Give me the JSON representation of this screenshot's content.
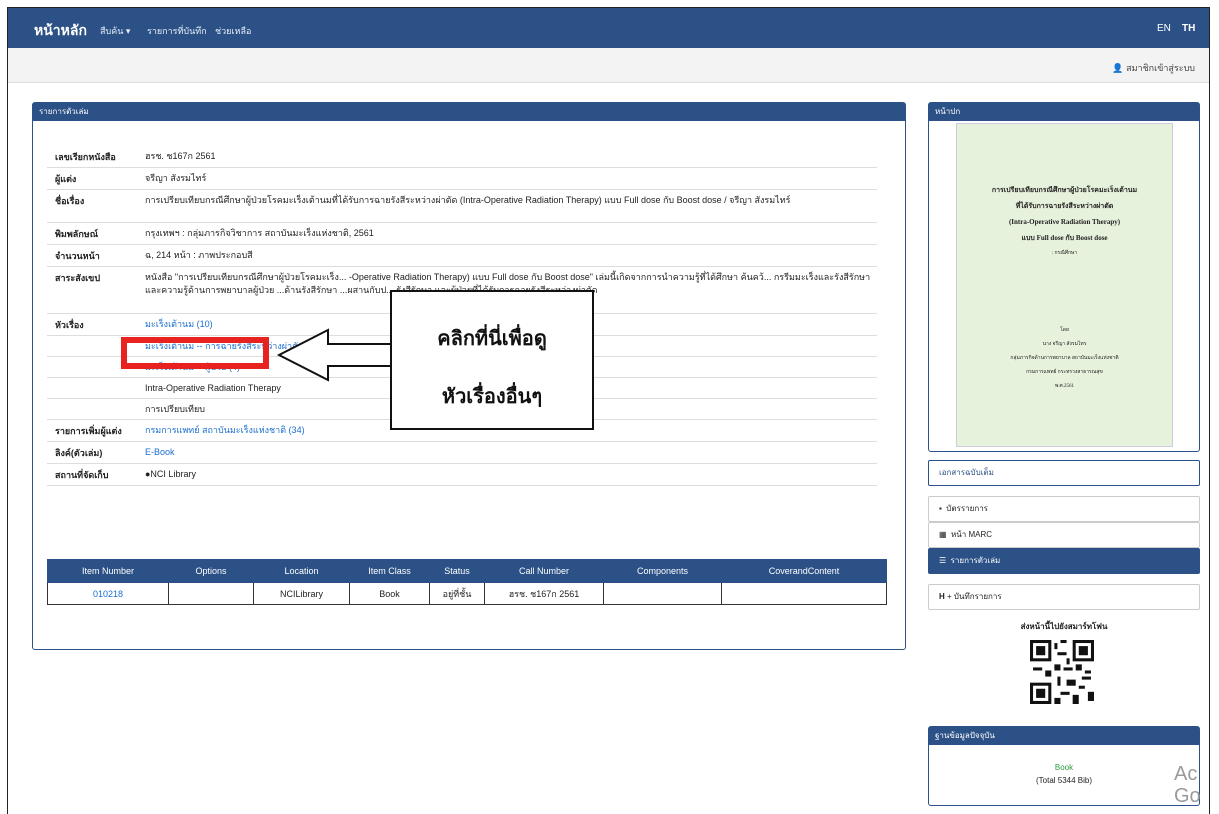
{
  "topnav": {
    "brand": "หน้าหลัก",
    "items": [
      "สืบค้น ▾",
      "รายการที่บันทึก",
      "ช่วยเหลือ"
    ],
    "lang_en": "EN",
    "lang_th": "TH"
  },
  "subbar": {
    "login": "สมาชิกเข้าสู่ระบบ"
  },
  "record": {
    "header": "รายการตัวเล่ม",
    "rows": [
      {
        "label": "เลขเรียกหนังสือ",
        "value": "ฮรช. ช167ก 2561"
      },
      {
        "label": "ผู้แต่ง",
        "value": "จรีญา สังรมไทร์"
      },
      {
        "label": "ชื่อเรื่อง",
        "value": "การเปรียบเทียบกรณีศึกษาผู้ป่วยโรคมะเร็งเต้านมที่ได้รับการฉายรังสีระหว่างผ่าตัด (Intra-Operative Radiation Therapy) แบบ Full dose กับ Boost dose / จรีญา สังรมไทร์"
      },
      {
        "label": "พิมพลักษณ์",
        "value": "กรุงเทพฯ : กลุ่มภารกิจวิชาการ สถาบันมะเร็งแห่งชาติ, 2561"
      },
      {
        "label": "จำนวนหน้า",
        "value": "ฉ, 214 หน้า : ภาพประกอบสี"
      },
      {
        "label": "สาระสังเขป",
        "value": "หนังสือ \"การเปรียบเทียบกรณีศึกษาผู้ป่วยโรคมะเร็ง... -Operative Radiation Therapy) แบบ Full dose กับ Boost dose\" เล่มนี้เกิดจากการนำความรู้ที่ได้ศึกษา ค้นคว้... กรรีมมะเร็งและรังสีรักษา และความรู้ด้านการพยาบาลผู้ป่วย ...ด้านรังสีรักษา ...ผสานกับป... รังสีรักษา และผู้ป่วยที่ได้รับการฉายรังสีระหว่างผ่าตัด"
      }
    ],
    "subject_label": "หัวเรื่อง",
    "subjects": [
      "มะเร็งเต้านม (10)",
      "มะเร็งเต้านม -- การฉายรังสีระหว่างผ่าตัด",
      "มะเร็งเต้านม -- ผู้ป่วย (4)",
      "Intra-Operative Radiation Therapy",
      "การเปรียบเทียบ"
    ],
    "added_author_label": "รายการเพิ่มผู้แต่ง",
    "added_author": "กรมการแพทย์ สถาบันมะเร็งแห่งชาติ (34)",
    "link_label": "ลิงค์(ตัวเล่ม)",
    "link": "E-Book",
    "location_label": "สถานที่จัดเก็บ",
    "location": "●NCI Library"
  },
  "items_table": {
    "headers": [
      "Item Number",
      "Options",
      "Location",
      "Item Class",
      "Status",
      "Call Number",
      "Components",
      "CoverandContent"
    ],
    "row": [
      "010218",
      "",
      "NCILibrary",
      "Book",
      "อยู่ที่ชั้น",
      "ฮรช. ช167ก 2561",
      "",
      ""
    ]
  },
  "cover": {
    "header": "หน้าปก",
    "lines": [
      "การเปรียบเทียบกรณีศึกษาผู้ป่วยโรคมะเร็งเต้านม",
      "ที่ได้รับการฉายรังสีระหว่างผ่าตัด",
      "(Intra-Operative Radiation Therapy)",
      "แบบ Full dose กับ Boost dose",
      ": กรณีศึกษา",
      "โดย",
      "นาง จรีญา สังรมไทร",
      "กลุ่มภารกิจด้านการพยาบาล สถาบันมะเร็งแห่งชาติ",
      "กรมการแพทย์ กระทรวงสาธารณสุข",
      "พ.ศ.2561"
    ]
  },
  "sidebar": {
    "attach": "เอกสารฉบับเต็ม",
    "buttons": [
      "บัตรรายการ",
      "หน้า MARC",
      "รายการตัวเล่ม",
      "+ บันทึกรายการ"
    ],
    "send_phone": "ส่งหน้านี้ไปยังสมาร์ทโฟน",
    "db_header": "ฐานข้อมูลปัจจุบัน",
    "db_type": "Book",
    "db_total": "(Total 5344 Bib)"
  },
  "callout": {
    "line1": "คลิกที่นี่เพื่อดู",
    "line2": "หัวเรื่องอื่นๆ"
  },
  "watermark": "Ac\nGo",
  "colors": {
    "nav": "#2c5186",
    "link": "#1a6fd0",
    "highlight": "#e8231f"
  }
}
